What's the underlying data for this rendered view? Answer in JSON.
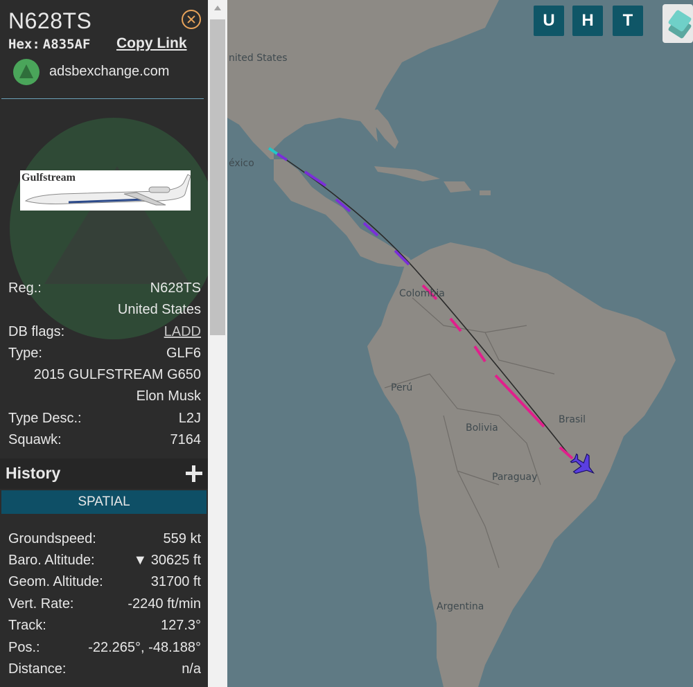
{
  "sidebar": {
    "callsign": "N628TS",
    "hex_label": "Hex:",
    "hex_value": "A835AF",
    "copy_link": "Copy Link",
    "source": "adsbexchange.com",
    "photo_brand": "Gulfstream",
    "reg_label": "Reg.:",
    "reg_value": "N628TS",
    "country": "United States",
    "dbflags_label": "DB flags:",
    "dbflags_value": "LADD",
    "type_label": "Type:",
    "type_value": "GLF6",
    "model": "2015 GULFSTREAM G650",
    "owner": "Elon Musk",
    "typedesc_label": "Type Desc.:",
    "typedesc_value": "L2J",
    "squawk_label": "Squawk:",
    "squawk_value": "7164",
    "history": "History",
    "spatial": "SPATIAL",
    "groundspeed_label": "Groundspeed:",
    "groundspeed_value": "559 kt",
    "baro_label": "Baro. Altitude:",
    "baro_value": "▼ 30625 ft",
    "geom_label": "Geom. Altitude:",
    "geom_value": "31700 ft",
    "vrate_label": "Vert. Rate:",
    "vrate_value": "-2240 ft/min",
    "track_label": "Track:",
    "track_value": "127.3°",
    "pos_label": "Pos.:",
    "pos_value": "-22.265°, -48.188°",
    "distance_label": "Distance:",
    "distance_value": "n/a"
  },
  "map": {
    "buttons": [
      "U",
      "H",
      "T"
    ],
    "labels": {
      "united_states": "nited States",
      "mexico": "éxico",
      "colombia": "Colombia",
      "peru": "Perú",
      "bolivia": "Bolivia",
      "brasil": "Brasil",
      "paraguay": "Paraguay",
      "argentina": "Argentina"
    },
    "colors": {
      "ocean": "#5f7a84",
      "land": "#8d8a85",
      "track_high": "#e0208c",
      "track_mid": "#7a2fd8",
      "aircraft": "#5a3fe0"
    }
  }
}
